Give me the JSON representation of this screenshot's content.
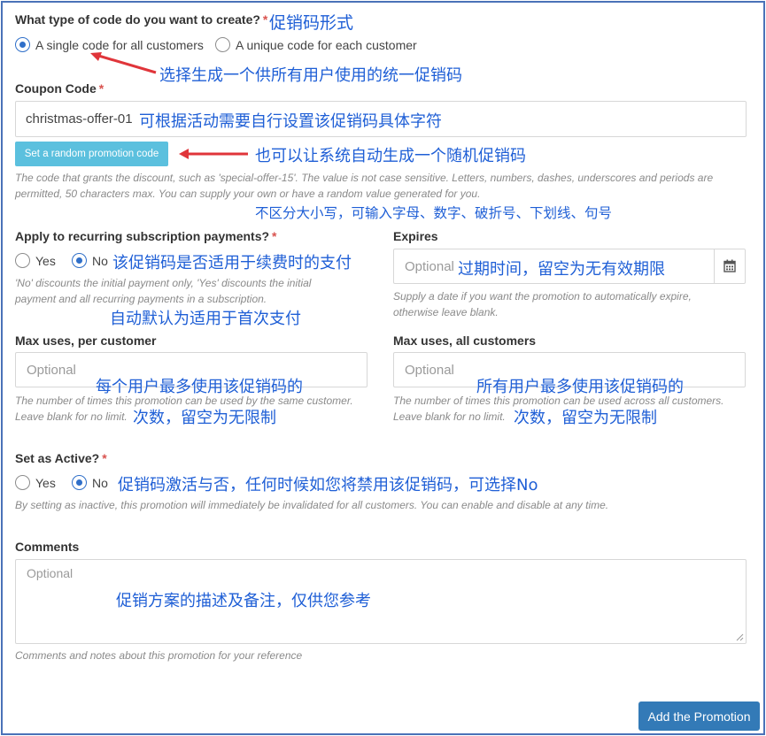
{
  "code_type": {
    "label": "What type of code do you want to create?",
    "required": "*",
    "annotation": "促销码形式",
    "options": [
      {
        "label": "A single code for all customers",
        "selected": true
      },
      {
        "label": "A unique code for each customer",
        "selected": false
      }
    ],
    "option_annotation": "选择生成一个供所有用户使用的统一促销码"
  },
  "coupon_code": {
    "label": "Coupon Code",
    "required": "*",
    "value": "christmas-offer-01",
    "annotation": "可根据活动需要自行设置该促销码具体字符",
    "random_button": "Set a random promotion code",
    "random_annotation": "也可以让系统自动生成一个随机促销码",
    "help_line1": "The code that grants the discount, such as 'special-offer-15'. The value is not case sensitive. Letters, numbers, dashes, underscores and periods are",
    "help_line2": "permitted, 50 characters max. You can supply your own or have a random value generated for you.",
    "help_annotation": "不区分大小写，可输入字母、数字、破折号、下划线、句号"
  },
  "recurring": {
    "label": "Apply to recurring subscription payments?",
    "required": "*",
    "yes": "Yes",
    "no": "No",
    "selected": "No",
    "annotation": "该促销码是否适用于续费时的支付",
    "help_line1": "'No' discounts the initial payment only, 'Yes' discounts the initial",
    "help_line2": "payment and all recurring payments in a subscription.",
    "help_annotation": "自动默认为适用于首次支付"
  },
  "expires": {
    "label": "Expires",
    "placeholder": "Optional",
    "annotation": "过期时间，留空为无有效期限",
    "icon": "calendar-icon",
    "help_line1": "Supply a date if you want the promotion to automatically expire,",
    "help_line2": "otherwise leave blank."
  },
  "max_per_customer": {
    "label": "Max uses, per customer",
    "placeholder": "Optional",
    "annotation_line1": "每个用户最多使用该促销码的",
    "annotation_line2": "次数，留空为无限制",
    "help_line1": "The number of times this promotion can be used by the same customer.",
    "help_line2": "Leave blank for no limit."
  },
  "max_all_customers": {
    "label": "Max uses, all customers",
    "placeholder": "Optional",
    "annotation_line1": "所有用户最多使用该促销码的",
    "annotation_line2": "次数，留空为无限制",
    "help_line1": "The number of times this promotion can be used across all customers.",
    "help_line2": "Leave blank for no limit."
  },
  "active": {
    "label": "Set as Active?",
    "required": "*",
    "yes": "Yes",
    "no": "No",
    "selected": "No",
    "annotation": "促销码激活与否，任何时候如您将禁用该促销码，可选择No",
    "help": "By setting as inactive, this promotion will immediately be invalidated for all customers. You can enable and disable at any time."
  },
  "comments": {
    "label": "Comments",
    "placeholder": "Optional",
    "annotation": "促销方案的描述及备注，仅供您参考",
    "help": "Comments and notes about this promotion for your reference"
  },
  "submit": {
    "label": "Add the Promotion"
  },
  "colors": {
    "annotation": "#1f5fd6",
    "arrow": "#e0353a",
    "required": "#d9534f",
    "primary": "#337ab7",
    "info": "#5bc0de",
    "frame": "#4a72b8"
  }
}
